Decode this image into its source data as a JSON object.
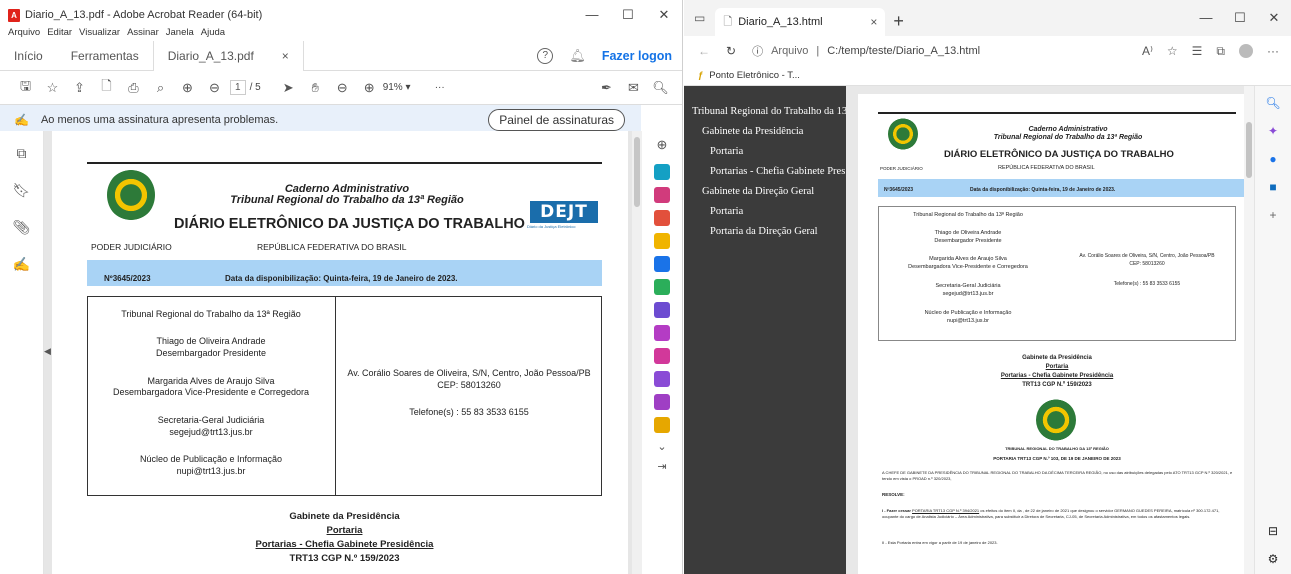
{
  "acrobat": {
    "title": "Diario_A_13.pdf - Adobe Acrobat Reader (64-bit)",
    "menu": [
      "Arquivo",
      "Editar",
      "Visualizar",
      "Assinar",
      "Janela",
      "Ajuda"
    ],
    "tabs": {
      "home": "Início",
      "tools": "Ferramentas",
      "doc": "Diario_A_13.pdf",
      "doc_close": "×"
    },
    "logon": "Fazer logon",
    "page_current": "1",
    "page_total": "/ 5",
    "zoom": "91%",
    "more": "···",
    "signature_message": "Ao menos uma assinatura apresenta problemas.",
    "signature_button": "Painel de assinaturas"
  },
  "pdf": {
    "header_line1": "Caderno Administrativo",
    "header_line2": "Tribunal Regional do Trabalho da 13ª Região",
    "main_title": "DIÁRIO ELETRÔNICO DA JUSTIÇA DO TRABALHO",
    "left_label": "PODER JUDICIÁRIO",
    "center_label": "REPÚBLICA FEDERATIVA DO BRASIL",
    "edition": "Nº3645/2023",
    "availability": "Data da disponibilização: Quinta-feira, 19 de Janeiro de 2023.",
    "dejt_logo": "DEJT",
    "dejt_sub": "Diário da Justiça Eletrônico",
    "court": "Tribunal Regional do Trabalho da 13ª Região",
    "p1_name": "Thiago de Oliveira Andrade",
    "p1_role": "Desembargador Presidente",
    "p2_name": "Margarida Alves de Araujo Silva",
    "p2_role": "Desembargadora Vice-Presidente e Corregedora",
    "sec_name": "Secretaria-Geral Judiciária",
    "sec_email": "segejud@trt13.jus.br",
    "nucleo": "Núcleo de Publicação e Informação",
    "nucleo_email": "nupi@trt13.jus.br",
    "address": "Av. Corálio Soares de Oliveira, S/N, Centro, João Pessoa/PB",
    "cep": "CEP: 58013260",
    "phone": "Telefone(s) : 55 83 3533 6155",
    "sec1": "Gabinete da Presidência",
    "sec2": "Portaria",
    "sec3": "Portarias - Chefia Gabinete Presidência",
    "sec4": "TRT13 CGP N.º 159/2023"
  },
  "edge": {
    "tab_title": "Diario_A_13.html",
    "tab_close": "×",
    "new_tab": "+",
    "url_label": "Arquivo",
    "url_sep": "|",
    "url": "C:/temp/teste/Diario_A_13.html",
    "favorite": "Ponto Eletrônico - T...",
    "nav": [
      {
        "label": "Tribunal Regional do Trabalho da 13...",
        "level": 0
      },
      {
        "label": "Gabinete da Presidência",
        "level": 1
      },
      {
        "label": "Portaria",
        "level": 2
      },
      {
        "label": "Portarias - Chefia Gabinete Pres...",
        "level": 2
      },
      {
        "label": "Gabinete da Direção Geral",
        "level": 1
      },
      {
        "label": "Portaria",
        "level": 2
      },
      {
        "label": "Portaria da Direção Geral",
        "level": 2
      }
    ],
    "html_doc": {
      "portaria_header": "TRIBUNAL REGIONAL DO TRABALHO DA 13ª REGIÃO",
      "portaria_title": "PORTARIA TRT13 CGP N.º 103, DE 19 DE JANEIRO DE 2023",
      "intro": "A CHEFE DE GABINETE DA PRESIDÊNCIA DO TRIBUNAL REGIONAL DO TRABALHO DA DÉCIMA TERCEIRA REGIÃO, no uso das atribuições delegadas pelo ATO TRT13 GCP N.º 320/2021, e tendo em vista o PROAD n.º 320/2023,",
      "resolve": "RESOLVE:",
      "art1_prefix": "I - Fazer cessar",
      "art1_link": "PORTARIA TRT13 CGP N.º 394/2021",
      "art1_rest": "os efeitos do item II, da  , de 22 de janeiro de 2021 que designou o servidor GERMANO GUEDES PEREIRA, matrícula nº 300.172.471, ocupante do cargo de Analista Judiciário – Área Administrativa, para substituir a Diretora de Secretaria, CJ-05, de Secretaria Administrativa, em todos os afastamentos legais.",
      "art2": "II - Esta Portaria entra em vigor a partir de 19 de janeiro de 2023."
    }
  }
}
